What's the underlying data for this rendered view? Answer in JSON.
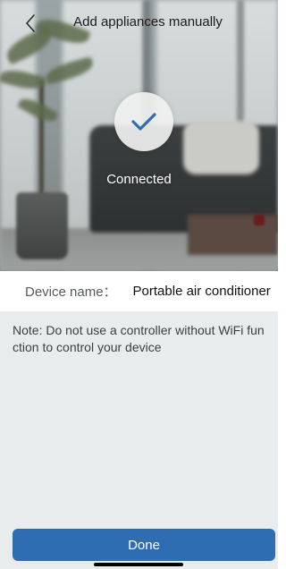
{
  "header": {
    "title": "Add appliances manually",
    "back_icon": "chevron-left-icon"
  },
  "status": {
    "icon": "checkmark-icon",
    "text": "Connected",
    "accent_color": "#2f6db3"
  },
  "device": {
    "label": "Device name：",
    "value": "Portable air conditioner"
  },
  "note": {
    "text": "Note: Do not use a controller without WiFi function to control your device"
  },
  "actions": {
    "done_label": "Done",
    "button_color": "#2f6db3"
  }
}
